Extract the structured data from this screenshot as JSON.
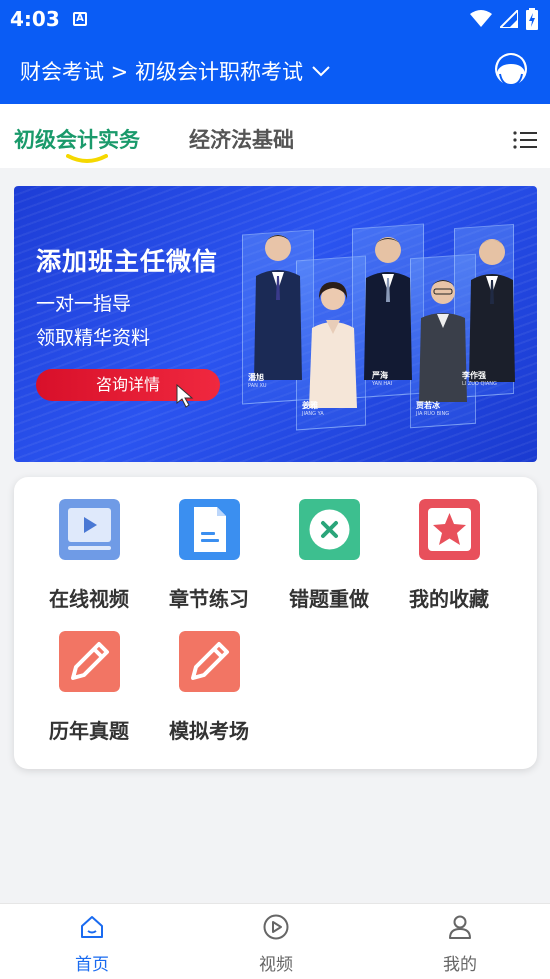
{
  "status_bar": {
    "time": "4:03",
    "a_badge": "A"
  },
  "header": {
    "title": "财会考试 > 初级会计职称考试"
  },
  "tabs": [
    {
      "label": "初级会计实务",
      "active": true
    },
    {
      "label": "经济法基础",
      "active": false
    }
  ],
  "banner": {
    "headline": "添加班主任微信",
    "line1": "一对一指导",
    "line2": "领取精华资料",
    "button": "咨询详情",
    "teachers": [
      {
        "name": "潘旭",
        "pinyin": "PAN XU"
      },
      {
        "name": "姜雅",
        "pinyin": "JIANG YA"
      },
      {
        "name": "严海",
        "pinyin": "YAN HAI"
      },
      {
        "name": "贾若冰",
        "pinyin": "JIA RUO BING"
      },
      {
        "name": "李作强",
        "pinyin": "LI ZUO QIANG"
      }
    ]
  },
  "grid": [
    {
      "label": "在线视频",
      "icon": "video-icon",
      "color": "#6a9ae8"
    },
    {
      "label": "章节练习",
      "icon": "document-icon",
      "color": "#3b8ff0"
    },
    {
      "label": "错题重做",
      "icon": "cross-circle-icon",
      "color": "#3dbf8f"
    },
    {
      "label": "我的收藏",
      "icon": "star-icon",
      "color": "#e8505b"
    },
    {
      "label": "历年真题",
      "icon": "pencil-icon",
      "color": "#f27564"
    },
    {
      "label": "模拟考场",
      "icon": "pencil-icon",
      "color": "#f27564"
    }
  ],
  "bottom_nav": [
    {
      "label": "首页",
      "icon": "home-icon",
      "active": true
    },
    {
      "label": "视频",
      "icon": "play-icon",
      "active": false
    },
    {
      "label": "我的",
      "icon": "person-icon",
      "active": false
    }
  ],
  "colors": {
    "primary": "#0a5cf5",
    "tab_active": "#1a9a6b",
    "nav_active": "#1a6bf0"
  }
}
